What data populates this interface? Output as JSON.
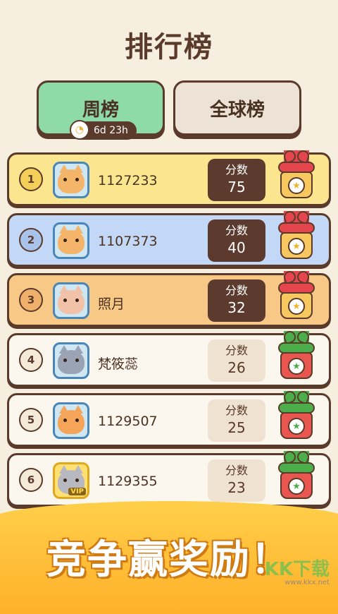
{
  "page": {
    "title": "排行榜"
  },
  "tabs": {
    "weekly": "周榜",
    "global": "全球榜",
    "timer": "6d 23h"
  },
  "score_label": "分数",
  "rows": [
    {
      "rank": "1",
      "name": "1127233",
      "score": "75",
      "bg": "#fbe58f",
      "rank_bg": "#f3cf5a",
      "avatar_color": "#f4b56a",
      "gift": "#e5464d",
      "gift_box": "#f7c860",
      "badge": "★",
      "score_style": "dark"
    },
    {
      "rank": "2",
      "name": "1107373",
      "score": "40",
      "bg": "#c3d8f6",
      "rank_bg": "#a8c2ea",
      "avatar_color": "#f4b56a",
      "gift": "#e5464d",
      "gift_box": "#f7c860",
      "badge": "★",
      "score_style": "dark"
    },
    {
      "rank": "3",
      "name": "照月",
      "score": "32",
      "bg": "#f7c886",
      "rank_bg": "#eeb06a",
      "avatar_color": "#f2c2a8",
      "gift": "#e5464d",
      "gift_box": "#f7c860",
      "badge": "★",
      "score_style": "dark"
    },
    {
      "rank": "4",
      "name": "梵筱蕊",
      "score": "26",
      "bg": "#fbf6ee",
      "rank_bg": "#f3ead8",
      "avatar_color": "#9aa3b4",
      "gift": "#4cae4a",
      "gift_box": "#e9554f",
      "badge": "★",
      "score_style": "light"
    },
    {
      "rank": "5",
      "name": "1129507",
      "score": "25",
      "bg": "#fbf6ee",
      "rank_bg": "#f3ead8",
      "avatar_color": "#f4a55a",
      "gift": "#4cae4a",
      "gift_box": "#e9554f",
      "badge": "★",
      "score_style": "light"
    },
    {
      "rank": "6",
      "name": "1129355",
      "score": "23",
      "bg": "#fbf6ee",
      "rank_bg": "#f3ead8",
      "avatar_color": "#b8b8c0",
      "gift": "#4cae4a",
      "gift_box": "#e9554f",
      "badge": "★",
      "score_style": "light",
      "vip": "VIP"
    }
  ],
  "banner": {
    "text": "竞争赢奖励！"
  },
  "watermark": {
    "main": "KK下载",
    "sub": "www.kkx.net"
  },
  "colors": {
    "background": "#f6efe0",
    "outline": "#5a3a2a",
    "tab_active": "#8fdba8",
    "banner": "#ffb02a"
  },
  "icons": {
    "timer": "clock-icon",
    "gift": "gift-box-icon"
  }
}
